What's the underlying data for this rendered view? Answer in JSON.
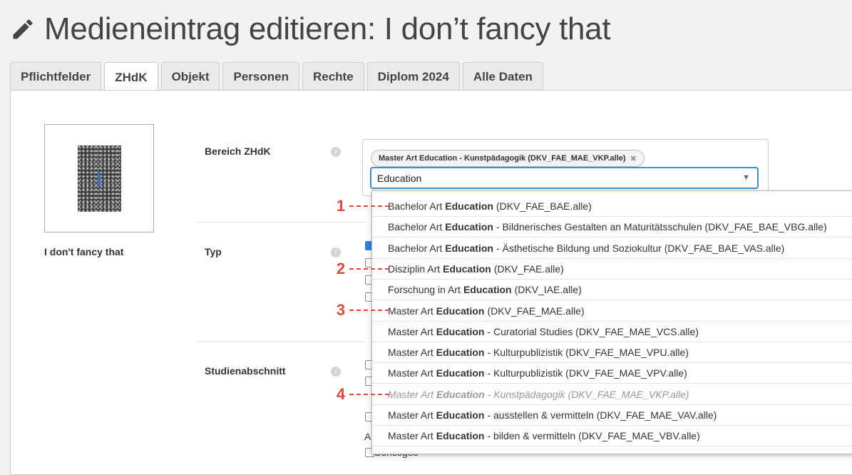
{
  "header": {
    "title": "Medieneintrag editieren: I don’t fancy that",
    "icon": "pencil-icon"
  },
  "tabs": [
    "Pflichtfelder",
    "ZHdK",
    "Objekt",
    "Personen",
    "Rechte",
    "Diplom 2024",
    "Alle Daten"
  ],
  "active_tab": "ZHdK",
  "media": {
    "caption": "I don't fancy that"
  },
  "fields": {
    "bereich": "Bereich ZHdK",
    "typ": "Typ",
    "studienabschnitt": "Studienabschnitt"
  },
  "selected_chip": {
    "label": "Master Art Education - Kunstpädagogik (DKV_FAE_MAE_VKP.alle)",
    "remove": "✖"
  },
  "search": {
    "value": "Education",
    "arrow": "▼"
  },
  "partial_texts": {
    "ac": "Ac",
    "sonstiges": "Sonstiges"
  },
  "dropdown": {
    "options": [
      {
        "pre": "Bachelor Art",
        "match": "Education",
        "post": "(DKV_FAE_BAE.alle)"
      },
      {
        "pre": "Bachelor Art",
        "match": "Education",
        "post": "- Bildnerisches Gestalten an Maturitätsschulen (DKV_FAE_BAE_VBG.alle)"
      },
      {
        "pre": "Bachelor Art",
        "match": "Education",
        "post": "- Ästhetische Bildung und Soziokultur (DKV_FAE_BAE_VAS.alle)"
      },
      {
        "pre": "Disziplin Art",
        "match": "Education",
        "post": "(DKV_FAE.alle)"
      },
      {
        "pre": "Forschung in Art",
        "match": "Education",
        "post": "(DKV_IAE.alle)"
      },
      {
        "pre": "Master Art",
        "match": "Education",
        "post": "(DKV_FAE_MAE.alle)"
      },
      {
        "pre": "Master Art",
        "match": "Education",
        "post": "- Curatorial Studies (DKV_FAE_MAE_VCS.alle)"
      },
      {
        "pre": "Master Art",
        "match": "Education",
        "post": "- Kulturpublizistik (DKV_FAE_MAE_VPU.alle)"
      },
      {
        "pre": "Master Art",
        "match": "Education",
        "post": "- Kulturpublizistik (DKV_FAE_MAE_VPV.alle)"
      },
      {
        "pre": "Master Art",
        "match": "Education",
        "post": "- Kunstpädagogik (DKV_FAE_MAE_VKP.alle)"
      },
      {
        "pre": "Master Art",
        "match": "Education",
        "post": "- ausstellen & vermitteln (DKV_FAE_MAE_VAV.alle)"
      },
      {
        "pre": "Master Art",
        "match": "Education",
        "post": "- bilden & vermitteln (DKV_FAE_MAE_VBV.alle)"
      }
    ],
    "disabled_index": 9
  },
  "markers": [
    "1",
    "2",
    "3",
    "4"
  ],
  "colors": {
    "accent": "#3b8fd9",
    "marker": "#e04a3b"
  }
}
